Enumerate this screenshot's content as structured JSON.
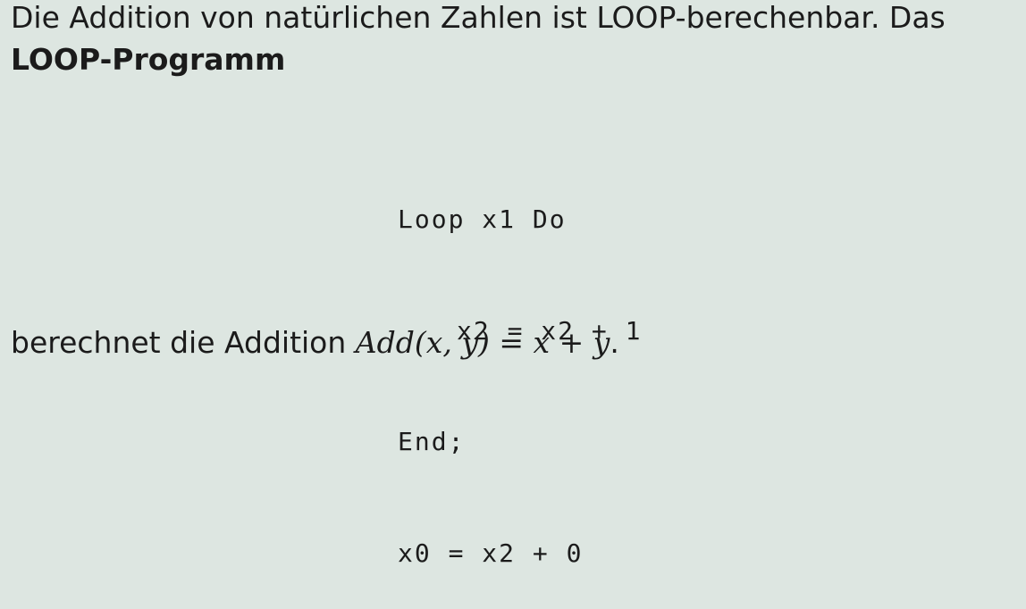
{
  "intro": {
    "line1": "Die Addition von natürlichen Zahlen ist LOOP-berechenbar. Das",
    "line2_bold": "LOOP-Programm"
  },
  "code": {
    "lines": [
      "Loop x1 Do",
      "x2 = x2 + 1",
      "End;",
      "x0 = x2 + 0"
    ]
  },
  "conclusion": {
    "text": "berechnet die Addition ",
    "formula": "Add(x, y) = x + y",
    "trailing": "."
  }
}
